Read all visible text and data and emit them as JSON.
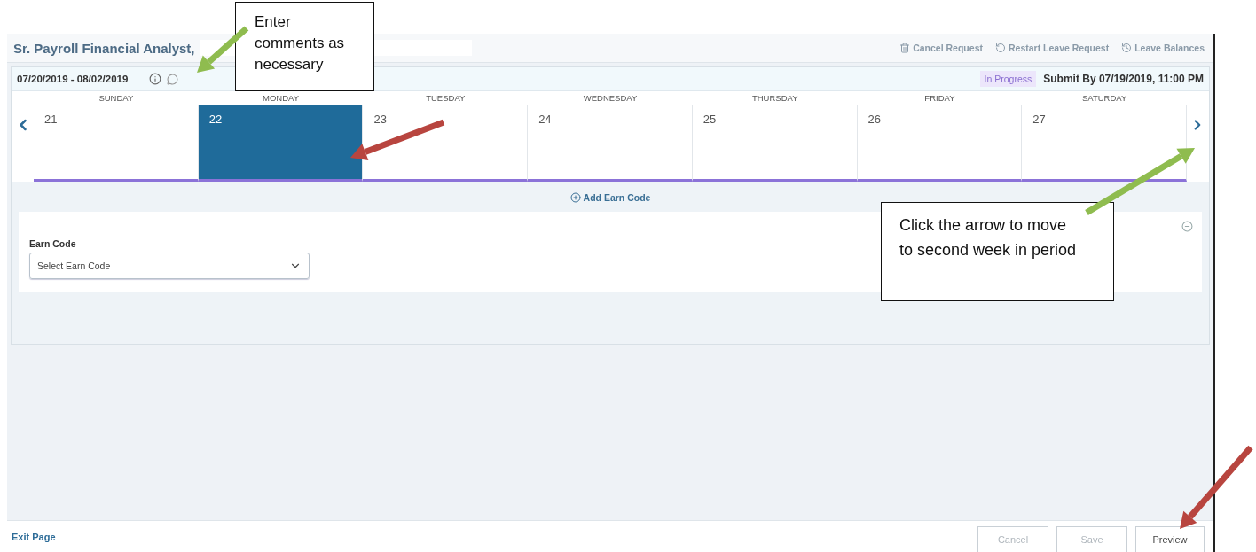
{
  "header": {
    "title": "Sr. Payroll Financial Analyst,",
    "actions": [
      {
        "kind": "trash",
        "label": "Cancel Request"
      },
      {
        "kind": "restart",
        "label": "Restart Leave Request"
      },
      {
        "kind": "balances",
        "label": "Leave Balances"
      }
    ]
  },
  "period": {
    "range": "07/20/2019 - 08/02/2019",
    "status": "In Progress",
    "deadline": "Submit By 07/19/2019, 11:00 PM"
  },
  "week": [
    {
      "name": "SUNDAY",
      "date": "21",
      "selected": false
    },
    {
      "name": "MONDAY",
      "date": "22",
      "selected": true
    },
    {
      "name": "TUESDAY",
      "date": "23",
      "selected": false
    },
    {
      "name": "WEDNESDAY",
      "date": "24",
      "selected": false
    },
    {
      "name": "THURSDAY",
      "date": "25",
      "selected": false
    },
    {
      "name": "FRIDAY",
      "date": "26",
      "selected": false
    },
    {
      "name": "SATURDAY",
      "date": "27",
      "selected": false
    }
  ],
  "add_earn_code": "Add Earn Code",
  "earn_code": {
    "label": "Earn Code",
    "placeholder": "Select Earn Code"
  },
  "footer": {
    "exit": "Exit Page",
    "buttons": [
      {
        "label": "Cancel",
        "disabled": true
      },
      {
        "label": "Save",
        "disabled": true
      },
      {
        "label": "Preview",
        "disabled": false
      }
    ]
  },
  "callouts": [
    {
      "text": "Enter comments as necessary"
    },
    {
      "text": "Click the arrow to move to second week in period"
    }
  ],
  "arrows": [
    {
      "color": "#8fbc4f"
    },
    {
      "color": "#b8453f"
    },
    {
      "color": "#8fbc4f"
    },
    {
      "color": "#b8453f"
    }
  ]
}
